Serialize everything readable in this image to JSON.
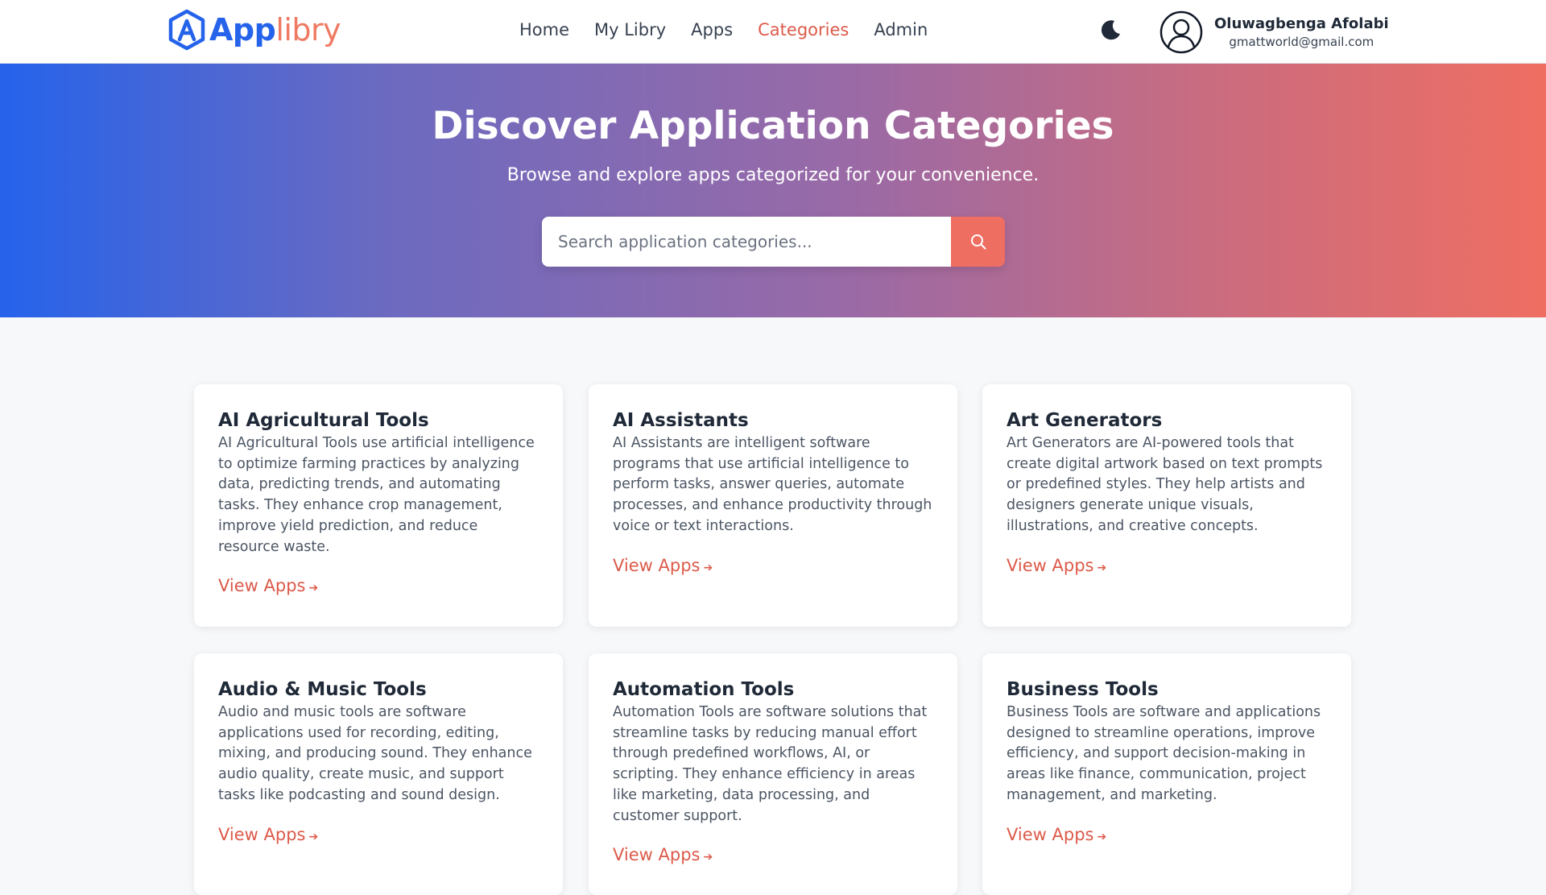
{
  "brand": {
    "name_part1": "App",
    "name_part2": "libry",
    "primary_color": "#2563eb",
    "accent_color": "#ef6e62"
  },
  "nav": {
    "items": [
      {
        "label": "Home",
        "active": false
      },
      {
        "label": "My Libry",
        "active": false
      },
      {
        "label": "Apps",
        "active": false
      },
      {
        "label": "Categories",
        "active": true
      },
      {
        "label": "Admin",
        "active": false
      }
    ]
  },
  "user": {
    "name": "Oluwagbenga Afolabi",
    "email": "gmattworld@gmail.com",
    "theme_icon": "moon-icon",
    "avatar_icon": "user-circle-icon"
  },
  "hero": {
    "title": "Discover Application Categories",
    "subtitle": "Browse and explore apps categorized for your convenience.",
    "search_placeholder": "Search application categories...",
    "search_value": "",
    "search_icon": "search-icon"
  },
  "categories": [
    {
      "title": "AI Agricultural Tools",
      "description": "AI Agricultural Tools use artificial intelligence to optimize farming practices by analyzing data, predicting trends, and automating tasks. They enhance crop management, improve yield prediction, and reduce resource waste.",
      "link": "View Apps",
      "arrow": "➔"
    },
    {
      "title": "AI Assistants",
      "description": "AI Assistants are intelligent software programs that use artificial intelligence to perform tasks, answer queries, automate processes, and enhance productivity through voice or text interactions.",
      "link": "View Apps",
      "arrow": "➔"
    },
    {
      "title": "Art Generators",
      "description": "Art Generators are AI-powered tools that create digital artwork based on text prompts or predefined styles. They help artists and designers generate unique visuals, illustrations, and creative concepts.",
      "link": "View Apps",
      "arrow": "➔"
    },
    {
      "title": "Audio & Music Tools",
      "description": "Audio and music tools are software applications used for recording, editing, mixing, and producing sound. They enhance audio quality, create music, and support tasks like podcasting and sound design.",
      "link": "View Apps",
      "arrow": "➔"
    },
    {
      "title": "Automation Tools",
      "description": "Automation Tools are software solutions that streamline tasks by reducing manual effort through predefined workflows, AI, or scripting. They enhance efficiency in areas like marketing, data processing, and customer support.",
      "link": "View Apps",
      "arrow": "➔"
    },
    {
      "title": "Business Tools",
      "description": "Business Tools are software and applications designed to streamline operations, improve efficiency, and support decision-making in areas like finance, communication, project management, and marketing.",
      "link": "View Apps",
      "arrow": "➔"
    }
  ]
}
